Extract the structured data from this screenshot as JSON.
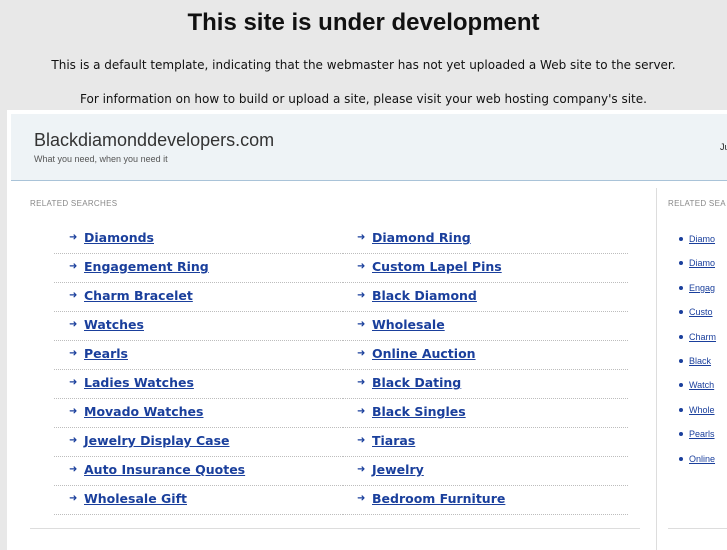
{
  "notice": {
    "title": "This site is under development",
    "line1": "This is a default template, indicating that the webmaster has not yet uploaded a Web site to the server.",
    "line2": "For information on how to build or upload a site, please visit your web hosting company's site."
  },
  "header": {
    "site_name": "Blackdiamonddevelopers.com",
    "tagline": "What you need, when you need it",
    "date_partial": "Ju"
  },
  "main": {
    "section_label": "RELATED SEARCHES",
    "left_column": [
      "Diamonds",
      "Engagement Ring",
      "Charm Bracelet",
      "Watches",
      "Pearls",
      "Ladies Watches",
      "Movado Watches",
      "Jewelry Display Case",
      "Auto Insurance Quotes",
      "Wholesale Gift"
    ],
    "right_column": [
      "Diamond Ring",
      "Custom Lapel Pins",
      "Black Diamond",
      "Wholesale",
      "Online Auction",
      "Black Dating",
      "Black Singles",
      "Tiaras",
      "Jewelry",
      "Bedroom Furniture"
    ]
  },
  "sidebar": {
    "section_label": "RELATED SEA",
    "items": [
      "Diamo",
      "Diamo",
      "Engag",
      "Custo",
      "Charm",
      "Black",
      "Watch",
      "Whole",
      "Pearls",
      "Online"
    ]
  },
  "icons": {
    "arrow": "right-arrow-icon",
    "bullet": "bullet-icon"
  },
  "colors": {
    "link": "#1a3f9c",
    "header_bg": "#eef3f6",
    "page_bg": "#e8e8e8"
  }
}
